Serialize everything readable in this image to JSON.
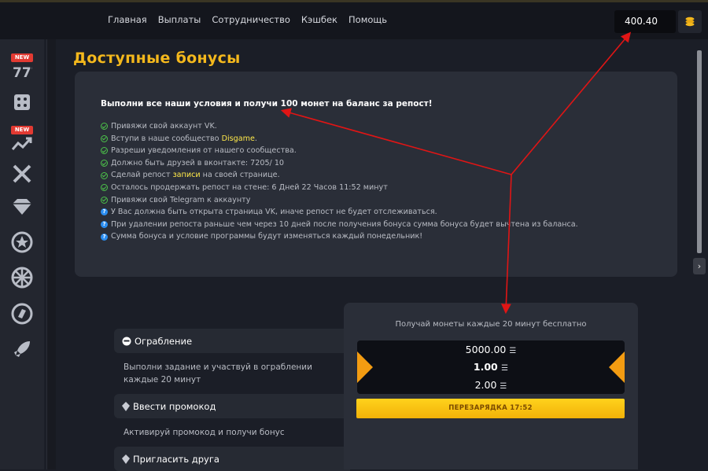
{
  "nav": {
    "items": [
      "Главная",
      "Выплаты",
      "Сотрудничество",
      "Кэшбек",
      "Помощь"
    ]
  },
  "balance": {
    "value": "400.40"
  },
  "sidebar": {
    "items": [
      {
        "icon": "slots-icon",
        "badge": "NEW"
      },
      {
        "icon": "dice-icon"
      },
      {
        "icon": "crash-chart-icon",
        "badge": "NEW"
      },
      {
        "icon": "crossed-swords-icon"
      },
      {
        "icon": "diamond-icon"
      },
      {
        "icon": "star-coin-icon"
      },
      {
        "icon": "wheel-icon"
      },
      {
        "icon": "circle-logo-icon"
      },
      {
        "icon": "rocket-icon"
      }
    ]
  },
  "page": {
    "title": "Доступные бонусы"
  },
  "info": {
    "headline": "Выполни все наши условия и получи 100 монет на баланс за репост!",
    "conditions": [
      {
        "type": "ok",
        "text": "Привяжи свой аккаунт VK."
      },
      {
        "type": "ok",
        "pre": "Вступи в наше сообщество ",
        "link": "Disgame",
        "post": "."
      },
      {
        "type": "ok",
        "text": "Разреши уведомления от нашего сообщества."
      },
      {
        "type": "ok",
        "text": "Должно быть друзей в вконтакте: 7205/ 10"
      },
      {
        "type": "ok",
        "pre": "Сделай репост ",
        "link": "записи",
        "post": " на своей странице."
      },
      {
        "type": "ok",
        "text": "Осталось продержать репост на стене: 6 Дней 22 Часов 11:52 минут"
      },
      {
        "type": "ok",
        "text": "Привяжи свой Telegram к аккаунту"
      },
      {
        "type": "q",
        "text": "У Вас должна быть открыта страница VK, иначе репост не будет отслеживаться."
      },
      {
        "type": "q",
        "text": "При удалении репоста раньше чем через 10 дней после получения бонуса сумма бонуса будет вычтена из баланса."
      },
      {
        "type": "q",
        "text": "Сумма бонуса и условие программы будут изменяться каждый понедельник!"
      }
    ]
  },
  "tasks": [
    {
      "icon": "robber-icon",
      "title": "Ограбление",
      "desc": "Выполни задание и участвуй в ограблении каждые 20 минут"
    },
    {
      "icon": "diamond-small-icon",
      "title": "Ввести промокод",
      "desc": "Активируй промокод и получи бонус"
    },
    {
      "icon": "diamond-small-icon",
      "title": "Пригласить друга",
      "desc": ""
    }
  ],
  "faucet": {
    "title": "Получай монеты каждые 20 минут бесплатно",
    "values": [
      "5000.00",
      "1.00",
      "2.00"
    ],
    "button": "ПЕРЕЗАРЯДКА 17:52",
    "accent": "#f39c12"
  },
  "colors": {
    "title": "#f4b81c",
    "annotation": "#e01515",
    "check": "#4cc24a",
    "info": "#2a8df0"
  }
}
